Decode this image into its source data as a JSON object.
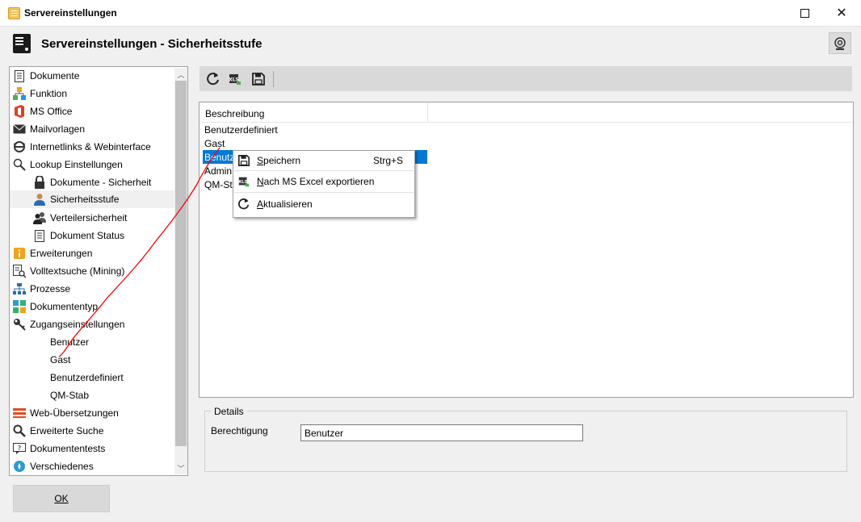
{
  "window": {
    "title": "Servereinstellungen"
  },
  "header": {
    "title": "Servereinstellungen - Sicherheitsstufe"
  },
  "tree": {
    "items": [
      {
        "label": "Dokumente",
        "icon": "document-icon"
      },
      {
        "label": "Funktion",
        "icon": "function-icon"
      },
      {
        "label": "MS Office",
        "icon": "office-icon"
      },
      {
        "label": "Mailvorlagen",
        "icon": "mail-icon"
      },
      {
        "label": "Internetlinks & Webinterface",
        "icon": "internet-icon"
      },
      {
        "label": "Lookup Einstellungen",
        "icon": "magnifier-icon"
      },
      {
        "label": "Dokumente - Sicherheit",
        "icon": "lock-icon"
      },
      {
        "label": "Sicherheitsstufe",
        "icon": "user-icon"
      },
      {
        "label": "Verteilersicherheit",
        "icon": "users-icon"
      },
      {
        "label": "Dokument Status",
        "icon": "document-status-icon"
      },
      {
        "label": "Erweiterungen",
        "icon": "info-icon"
      },
      {
        "label": "Volltextsuche (Mining)",
        "icon": "fulltext-search-icon"
      },
      {
        "label": "Prozesse",
        "icon": "process-icon"
      },
      {
        "label": "Dokumententyp",
        "icon": "document-type-icon"
      },
      {
        "label": "Zugangseinstellungen",
        "icon": "key-icon"
      },
      {
        "label": "Benutzer",
        "icon": ""
      },
      {
        "label": "Gast",
        "icon": ""
      },
      {
        "label": "Benutzerdefiniert",
        "icon": ""
      },
      {
        "label": "QM-Stab",
        "icon": ""
      },
      {
        "label": "Web-Übersetzungen",
        "icon": "translation-icon"
      },
      {
        "label": "Erweiterte Suche",
        "icon": "advanced-search-icon"
      },
      {
        "label": "Dokumententests",
        "icon": "test-icon"
      },
      {
        "label": "Verschiedenes",
        "icon": "misc-icon"
      }
    ]
  },
  "toolbar": {
    "buttons": [
      "refresh-icon",
      "excel-export-icon",
      "save-icon"
    ]
  },
  "grid": {
    "column_header": "Beschreibung",
    "rows": [
      "Benutzerdefiniert",
      "Gast",
      "Benutzer",
      "Admin",
      "QM-Stab"
    ],
    "selected_row": "Benutzer"
  },
  "context_menu": {
    "items": [
      {
        "label": "Speichern",
        "shortcut": "Strg+S",
        "icon": "save-icon"
      },
      {
        "label": "Nach MS Excel exportieren",
        "shortcut": "",
        "icon": "excel-export-icon"
      },
      {
        "label": "Aktualisieren",
        "shortcut": "",
        "icon": "refresh-icon"
      }
    ]
  },
  "details": {
    "legend": "Details",
    "berechtigung_label": "Berechtigung",
    "berechtigung_value": "Benutzer"
  },
  "ok_button": "OK",
  "colors": {
    "selection": "#0078d7",
    "annotation": "#ff0000"
  }
}
